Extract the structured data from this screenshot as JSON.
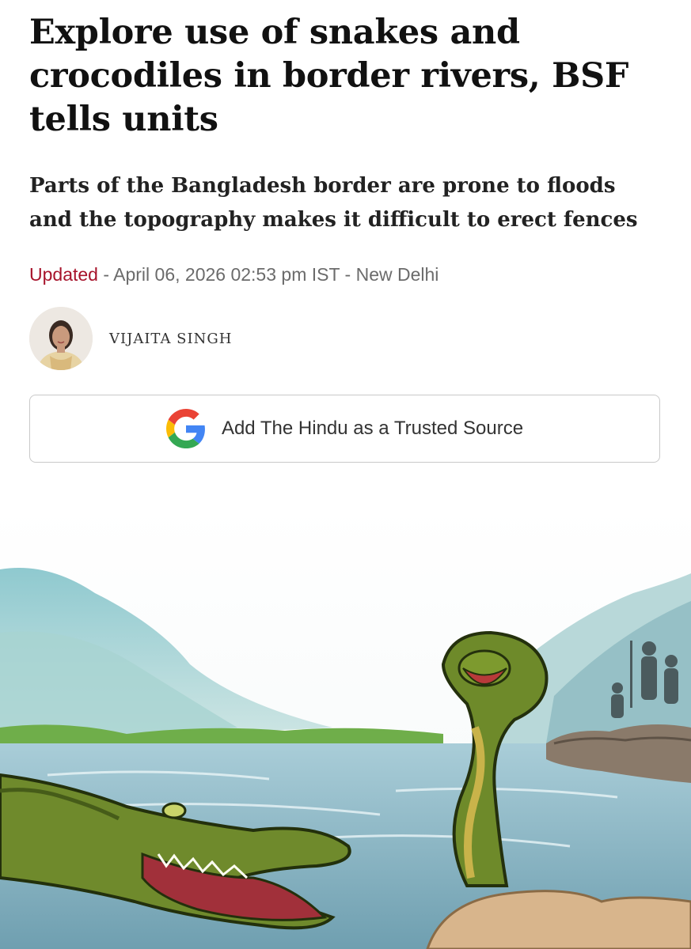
{
  "article": {
    "headline": "Explore use of snakes and crocodiles in border rivers, BSF tells units",
    "subheadline": "Parts of the Bangladesh border are prone to floods and the topography makes it difficult to erect fences",
    "meta": {
      "updated_label": "Updated",
      "separator": " - ",
      "date": "April 06, 2026 02:53 pm IST",
      "location": "New Delhi"
    },
    "author": {
      "name": "VIJAITA SINGH"
    },
    "trusted_source_button": {
      "label": "Add The Hindu as a Trusted Source",
      "icon": "google-g-icon"
    },
    "illustration": {
      "depicts": "crocodile-and-cobra-river-illustration"
    }
  },
  "colors": {
    "updated_accent": "#a7132b",
    "meta_text": "#6b6b6b",
    "button_border": "#c9c9c9",
    "google_blue": "#4285F4",
    "google_red": "#EA4335",
    "google_yellow": "#FBBC05",
    "google_green": "#34A853"
  }
}
